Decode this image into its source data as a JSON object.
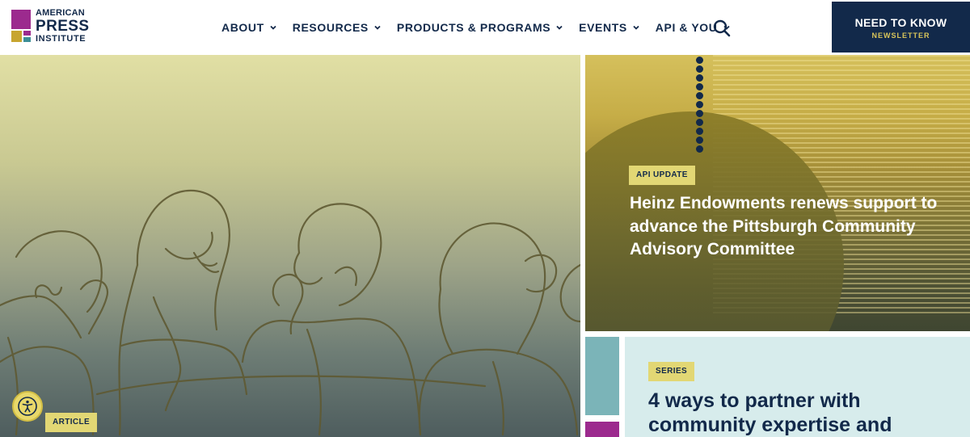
{
  "brand": {
    "line1": "AMERICAN",
    "line2": "PRESS",
    "line3": "INSTITUTE",
    "colors": {
      "navy": "#12294a",
      "purple": "#9c2a8e",
      "gold": "#c7a52f",
      "teal": "#3c8e96"
    }
  },
  "nav": {
    "items": [
      {
        "label": "ABOUT"
      },
      {
        "label": "RESOURCES"
      },
      {
        "label": "PRODUCTS & PROGRAMS"
      },
      {
        "label": "EVENTS"
      },
      {
        "label": "API & YOU"
      }
    ],
    "search_icon": "search-icon"
  },
  "newsletter": {
    "title": "NEED TO KNOW",
    "subtitle": "NEWSLETTER"
  },
  "hero": {
    "tag": "ARTICLE",
    "accessibility_icon": "accessibility-icon"
  },
  "cards": [
    {
      "tag": "API UPDATE",
      "headline": "Heinz Endowments renews support to advance the Pittsburgh Community Advisory Committee"
    },
    {
      "tag": "SERIES",
      "headline": "4 ways to partner with community expertise and"
    }
  ]
}
